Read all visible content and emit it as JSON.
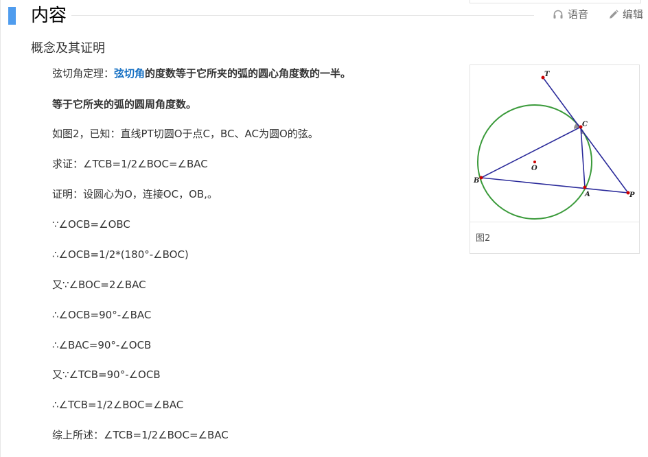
{
  "header": {
    "title": "内容",
    "voice_label": "语音",
    "edit_label": "编辑",
    "accent": "#4f9cee"
  },
  "section": {
    "subtitle": "概念及其证明"
  },
  "content": {
    "theorem_prefix": "弦切角定理：",
    "theorem_link": "弦切角",
    "theorem_rest": "的度数等于它所夹的弧的圆心角度数的一半。",
    "line2": "等于它所夹的弧的圆周角度数。",
    "lines": [
      "如图2，已知：直线PT切圆O于点C，BC、AC为圆O的弦。",
      "求证：∠TCB=1/2∠BOC=∠BAC",
      "证明：设圆心为O，连接OC，OB,。",
      "∵∠OCB=∠OBC",
      "∴∠OCB=1/2*(180°-∠BOC)",
      "又∵∠BOC=2∠BAC",
      "∴∠OCB=90°-∠BAC",
      "∴∠BAC=90°-∠OCB",
      "又∵∠TCB=90°-∠OCB",
      "∴∠TCB=1/2∠BOC=∠BAC",
      "综上所述：∠TCB=1/2∠BOC=∠BAC"
    ]
  },
  "figure": {
    "caption": "图2",
    "labels": {
      "T": "T",
      "C": "C",
      "O": "O",
      "B": "B",
      "A": "A",
      "P": "P"
    },
    "colors": {
      "circle": "#3a9a3a",
      "lines": "#2a2a9a",
      "points": "#cc0000"
    }
  }
}
